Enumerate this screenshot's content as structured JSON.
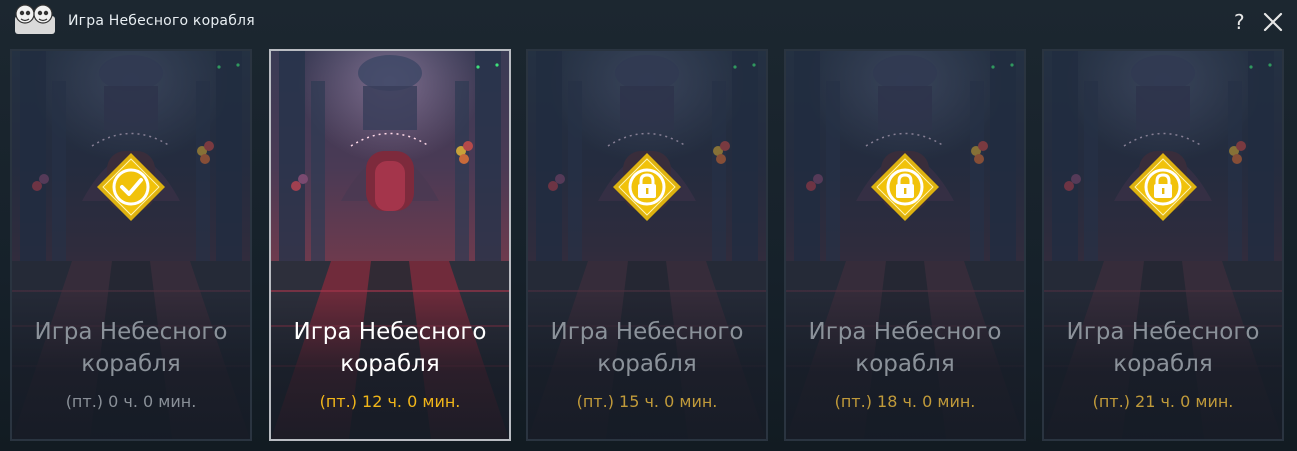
{
  "window": {
    "title": "Игра Небесного корабля",
    "help_label": "?",
    "icons": {
      "logo": "mascot-logo-icon",
      "help": "help-icon",
      "close": "close-icon"
    }
  },
  "colors": {
    "accent_gold": "#f1b619",
    "badge_gold": "#e7b90d",
    "dim_text": "#8b929a"
  },
  "cards": [
    {
      "name": "Игра Небесного корабля",
      "time": "(пт.) 0 ч. 0 мин.",
      "state": "completed",
      "icon": "check-icon"
    },
    {
      "name": "Игра Небесного корабля",
      "time": "(пт.) 12 ч. 0 мин.",
      "state": "active",
      "icon": ""
    },
    {
      "name": "Игра Небесного корабля",
      "time": "(пт.) 15 ч. 0 мин.",
      "state": "locked",
      "icon": "lock-icon"
    },
    {
      "name": "Игра Небесного корабля",
      "time": "(пт.) 18 ч. 0 мин.",
      "state": "locked",
      "icon": "lock-icon"
    },
    {
      "name": "Игра Небесного корабля",
      "time": "(пт.) 21 ч. 0 мин.",
      "state": "locked",
      "icon": "lock-icon"
    }
  ]
}
